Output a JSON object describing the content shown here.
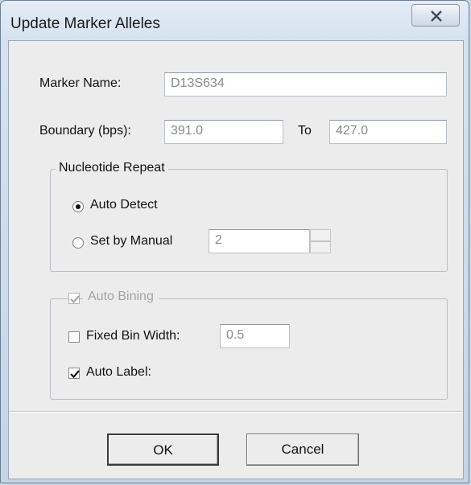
{
  "window": {
    "title": "Update Marker Alleles"
  },
  "marker": {
    "name_label": "Marker Name:",
    "name_value": "D13S634"
  },
  "boundary": {
    "label": "Boundary (bps):",
    "from_value": "391.0",
    "to_label": "To",
    "to_value": "427.0"
  },
  "nucleotide_repeat": {
    "group_label": "Nucleotide Repeat",
    "auto_detect_label": "Auto Detect",
    "auto_detect_selected": true,
    "manual_label": "Set by Manual",
    "manual_value": "2"
  },
  "auto_binning": {
    "group_label": "Auto Bining",
    "group_checked": true,
    "fixed_bin_width_label": "Fixed Bin Width:",
    "fixed_bin_width_checked": false,
    "fixed_bin_width_value": "0.5",
    "auto_label_label": "Auto Label:",
    "auto_label_checked": true
  },
  "buttons": {
    "ok_label": "OK",
    "cancel_label": "Cancel"
  }
}
